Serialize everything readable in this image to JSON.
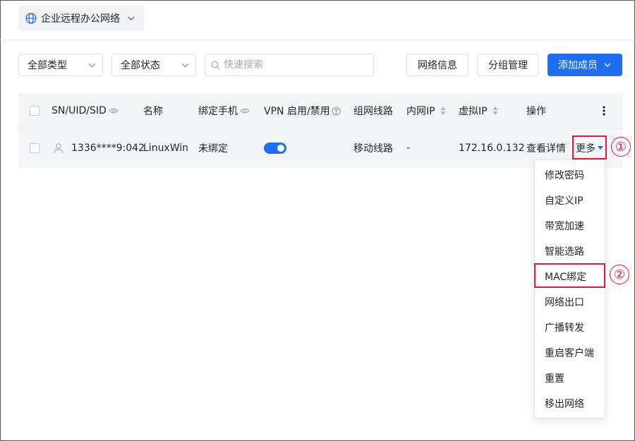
{
  "header": {
    "network_name": "企业远程办公网络"
  },
  "filters": {
    "type_select": "全部类型",
    "status_select": "全部状态",
    "search_placeholder": "快速搜索",
    "network_info_button": "网络信息",
    "group_manage_button": "分组管理",
    "add_member_button": "添加成员"
  },
  "table": {
    "columns": {
      "sn": "SN/UID/SID",
      "name": "名称",
      "phone": "绑定手机",
      "vpn": "VPN 启用/禁用",
      "line": "组网线路",
      "lan_ip": "内网IP",
      "virtual_ip": "虚拟IP",
      "actions": "操作"
    },
    "rows": [
      {
        "sn": "1336****9:042",
        "name": "LinuxWin",
        "phone": "未绑定",
        "vpn_enabled": true,
        "line": "移动线路",
        "lan_ip": "-",
        "virtual_ip": "172.16.0.132",
        "detail_link": "查看详情",
        "more_link": "更多"
      }
    ]
  },
  "more_menu": {
    "items": [
      "修改密码",
      "自定义IP",
      "带宽加速",
      "智能选路",
      "MAC绑定",
      "网络出口",
      "广播转发",
      "重启客户端",
      "重置",
      "移出网络"
    ],
    "highlighted_item": "MAC绑定"
  },
  "annotations": {
    "marker_1": "①",
    "marker_2": "②"
  },
  "colors": {
    "primary": "#1f6ef0",
    "annotation": "#e8173c",
    "header_bg": "#f4f5f7"
  }
}
